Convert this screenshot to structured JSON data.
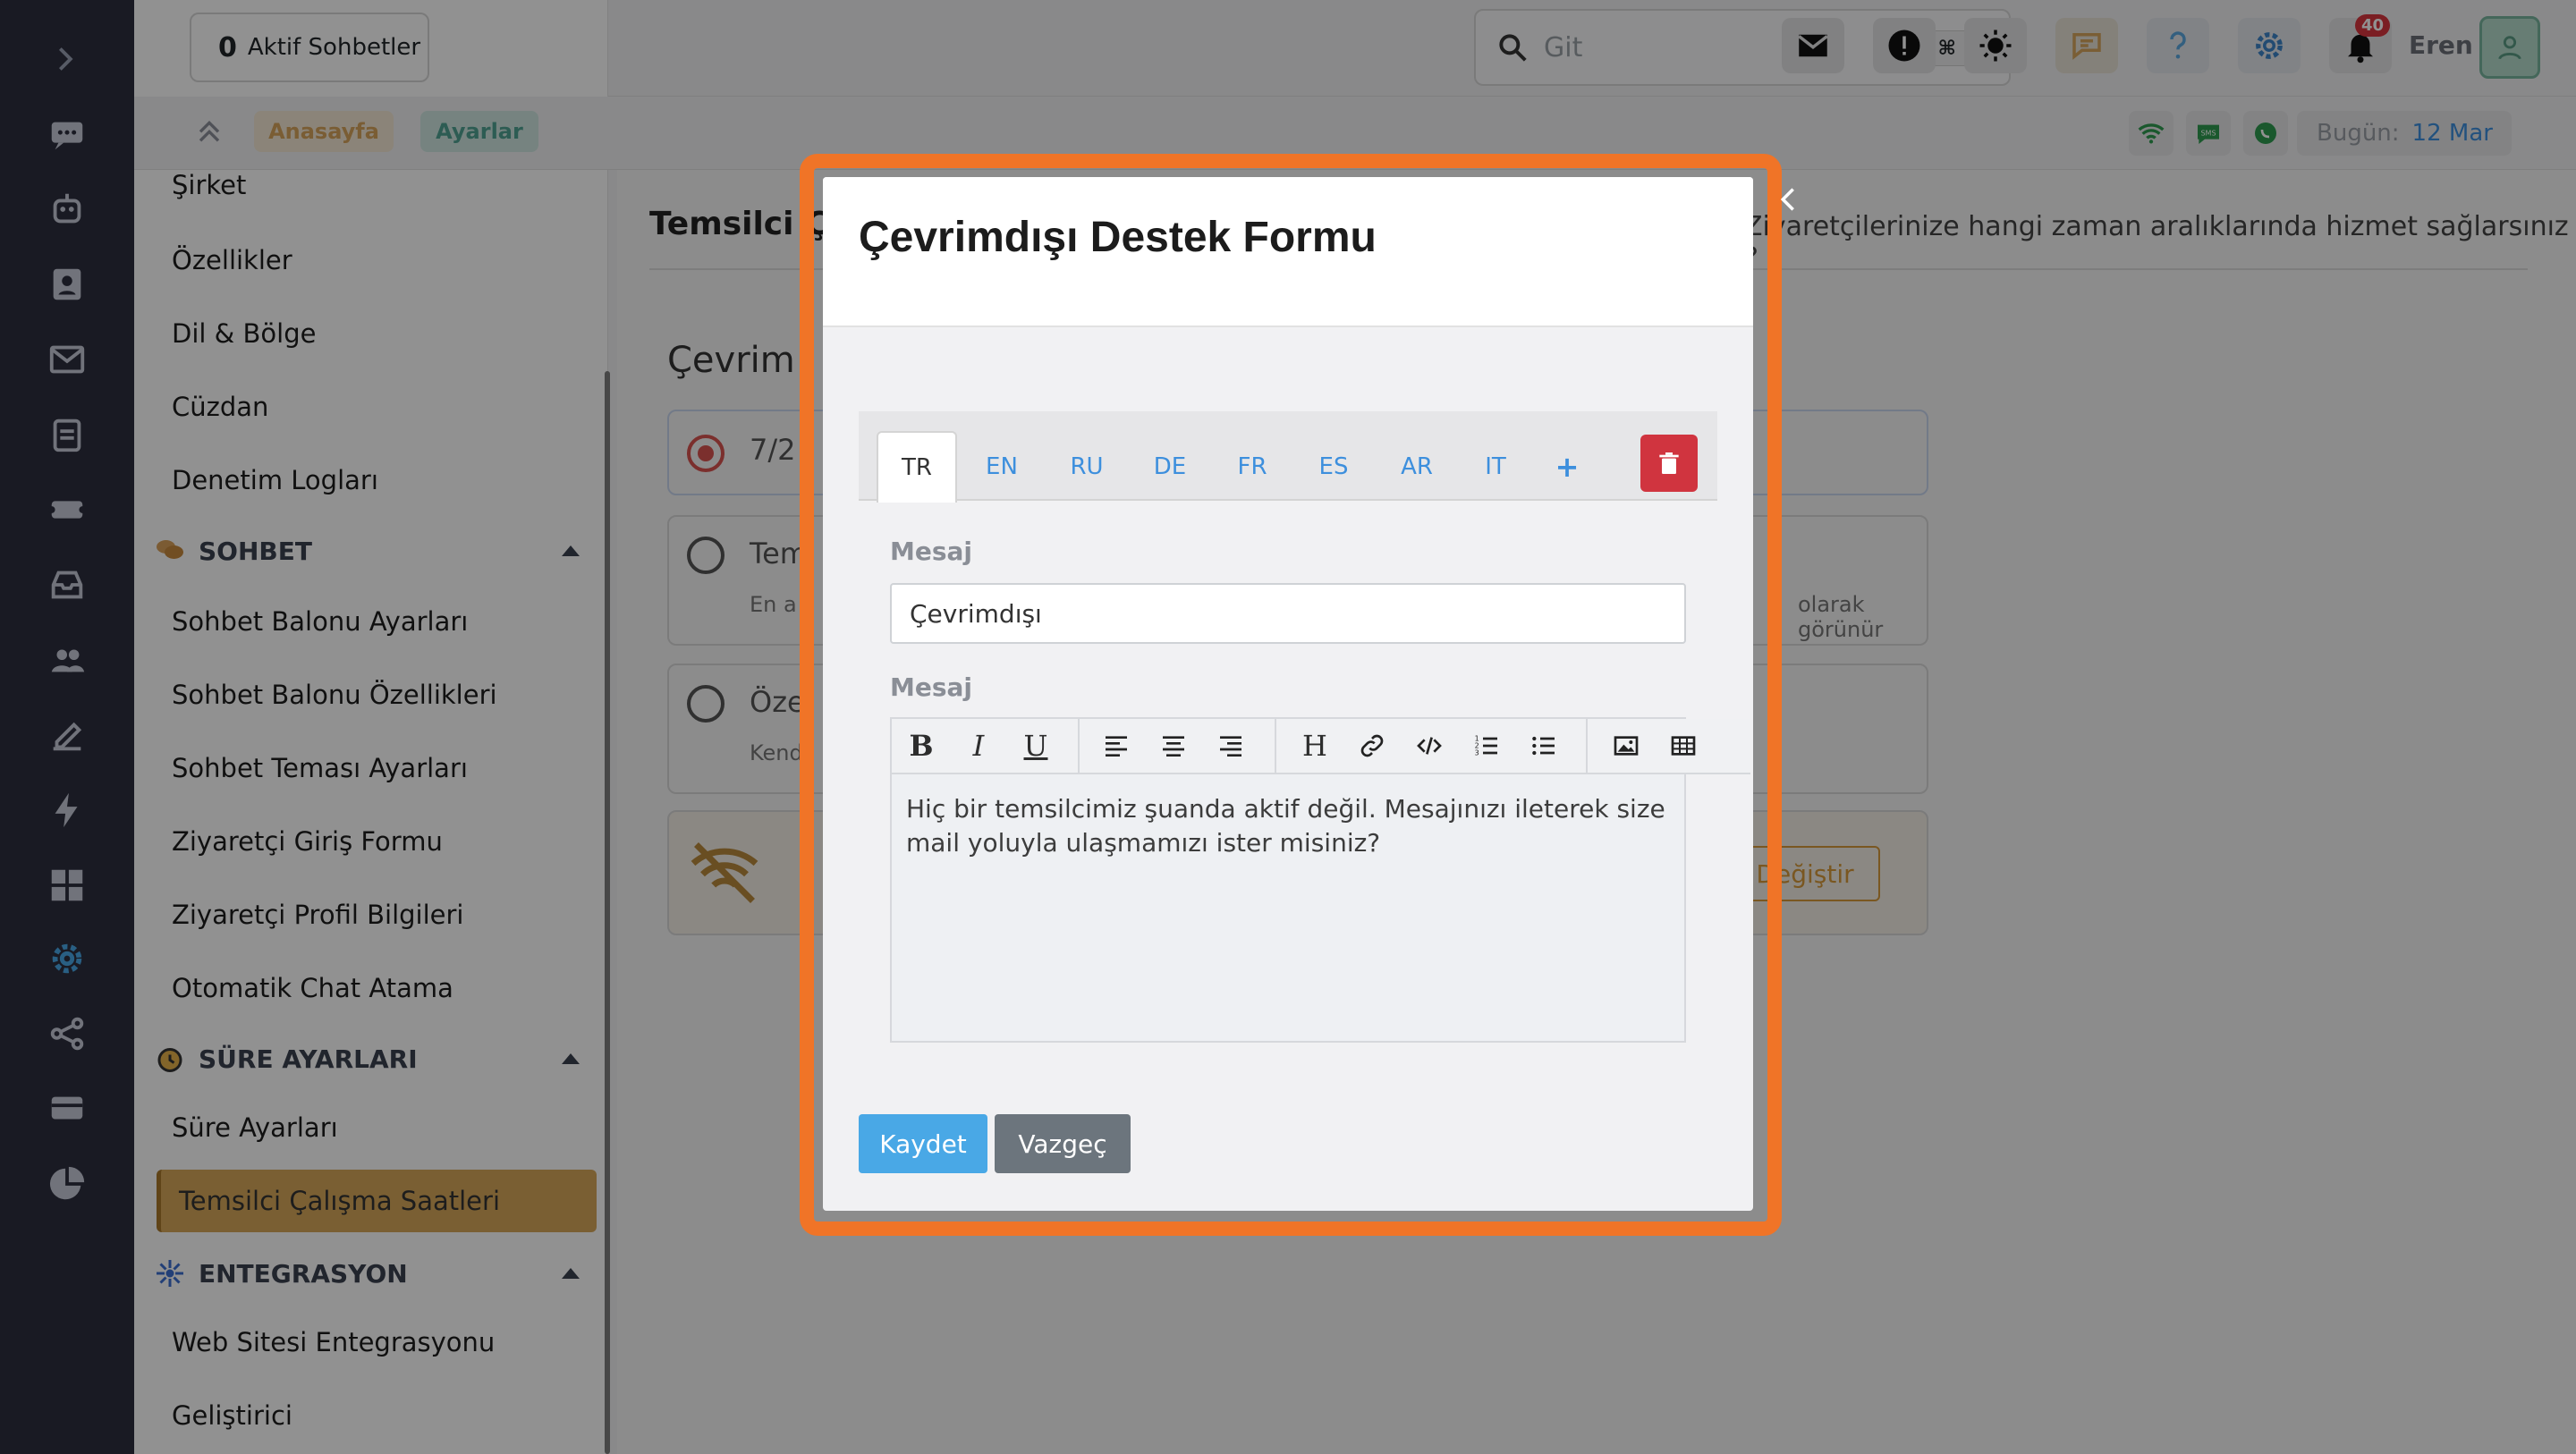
{
  "sidebar": {
    "active_chats_count": "0",
    "active_chats_label": "Aktif Sohbetler",
    "items_top": [
      "Şirket",
      "Özellikler",
      "Dil & Bölge",
      "Cüzdan",
      "Denetim Logları"
    ],
    "section_chat": "SOHBET",
    "chat_items": [
      "Sohbet Balonu Ayarları",
      "Sohbet Balonu Özellikleri",
      "Sohbet Teması Ayarları",
      "Ziyaretçi Giriş Formu",
      "Ziyaretçi Profil Bilgileri",
      "Otomatik Chat Atama"
    ],
    "section_time": "SÜRE AYARLARI",
    "time_items": [
      "Süre Ayarları",
      "Temsilci Çalışma Saatleri"
    ],
    "section_integration": "ENTEGRASYON",
    "integration_items": [
      "Web Sitesi Entegrasyonu",
      "Geliştirici"
    ]
  },
  "topbar": {
    "search_placeholder": "Git",
    "search_shortcut": "⌘ K",
    "notification_count": "40",
    "username": "Eren"
  },
  "breadcrumb": {
    "home": "Anasayfa",
    "current": "Ayarlar",
    "today_label": "Bugün:",
    "today_value": "12 Mar"
  },
  "main": {
    "title_partial": "Temsilci Ç",
    "hint_partial": "Ziyaretçilerinize hangi zaman aralıklarında hizmet sağlarsınız ?",
    "section_partial": "Çevrim",
    "option1_partial": "7/2",
    "option2_partial": "Tem",
    "option2_sub_partial": "En a",
    "option2_sub_right": "olarak görünür",
    "option3_partial": "Öze",
    "option3_sub_partial": "Kend",
    "change_button_partial": "a Değiştir"
  },
  "modal": {
    "title": "Çevrimdışı Destek Formu",
    "tabs": [
      "TR",
      "EN",
      "RU",
      "DE",
      "FR",
      "ES",
      "AR",
      "IT",
      "+"
    ],
    "active_tab": "TR",
    "message_label": "Mesaj",
    "message_value": "Çevrimdışı",
    "body_label": "Mesaj",
    "body_text": "Hiç bir temsilcimiz şuanda aktif değil. Mesajınızı ileterek size mail yoluyla ulaşmamızı ister misiniz?",
    "save_label": "Kaydet",
    "cancel_label": "Vazgeç"
  },
  "colors": {
    "accent_orange": "#f07427",
    "primary_blue": "#49a8e6",
    "danger_red": "#d0343f",
    "sidebar_active": "#d6a85a"
  }
}
